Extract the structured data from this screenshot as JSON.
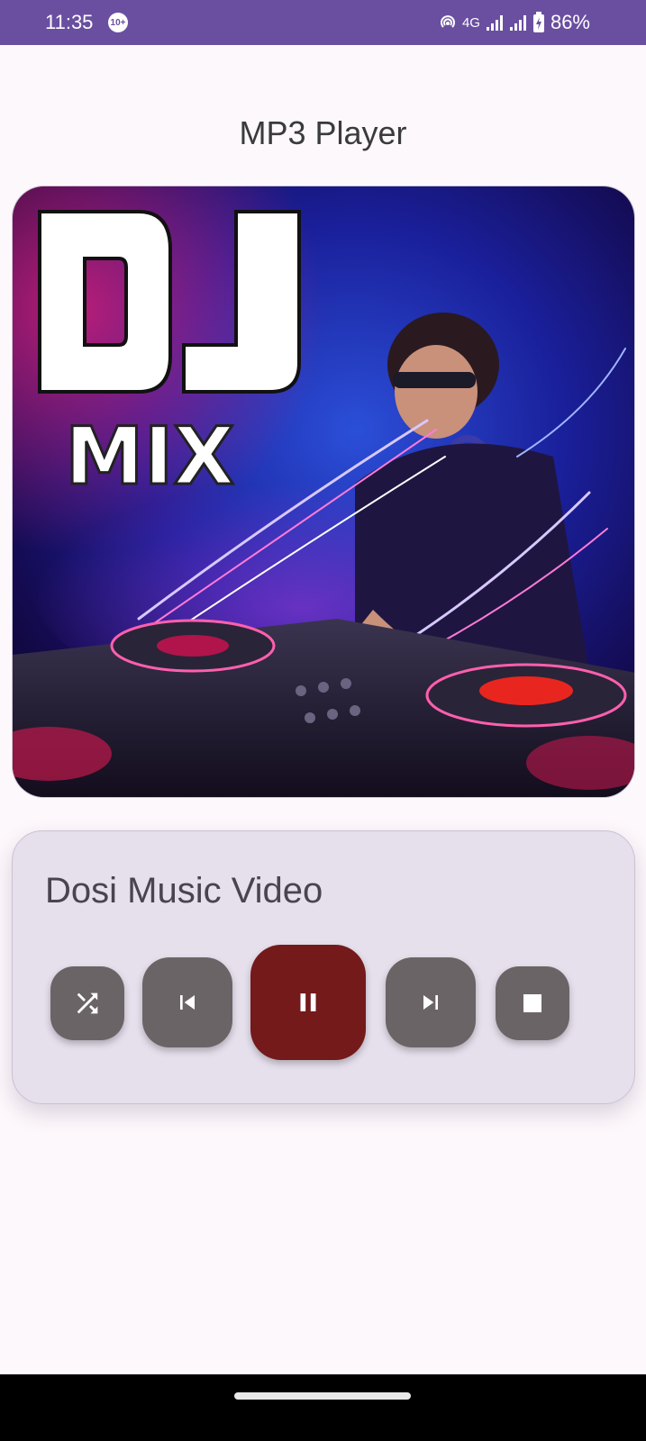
{
  "status_bar": {
    "time": "11:35",
    "notification_badge": "10+",
    "network": "4G",
    "battery": "86%"
  },
  "app": {
    "title": "MP3 Player"
  },
  "album_art": {
    "text_line1": "DJ",
    "text_line2": "MIX"
  },
  "player": {
    "track_title": "Dosi Music Video",
    "controls": {
      "shuffle_icon": "shuffle-icon",
      "previous_icon": "skip-previous-icon",
      "pause_icon": "pause-icon",
      "next_icon": "skip-next-icon",
      "stop_icon": "stop-icon"
    }
  },
  "colors": {
    "status_bar": "#6a4fa0",
    "card_background": "#e6e0ed",
    "control_button": "#6b6466",
    "pause_button": "#741a1a"
  }
}
